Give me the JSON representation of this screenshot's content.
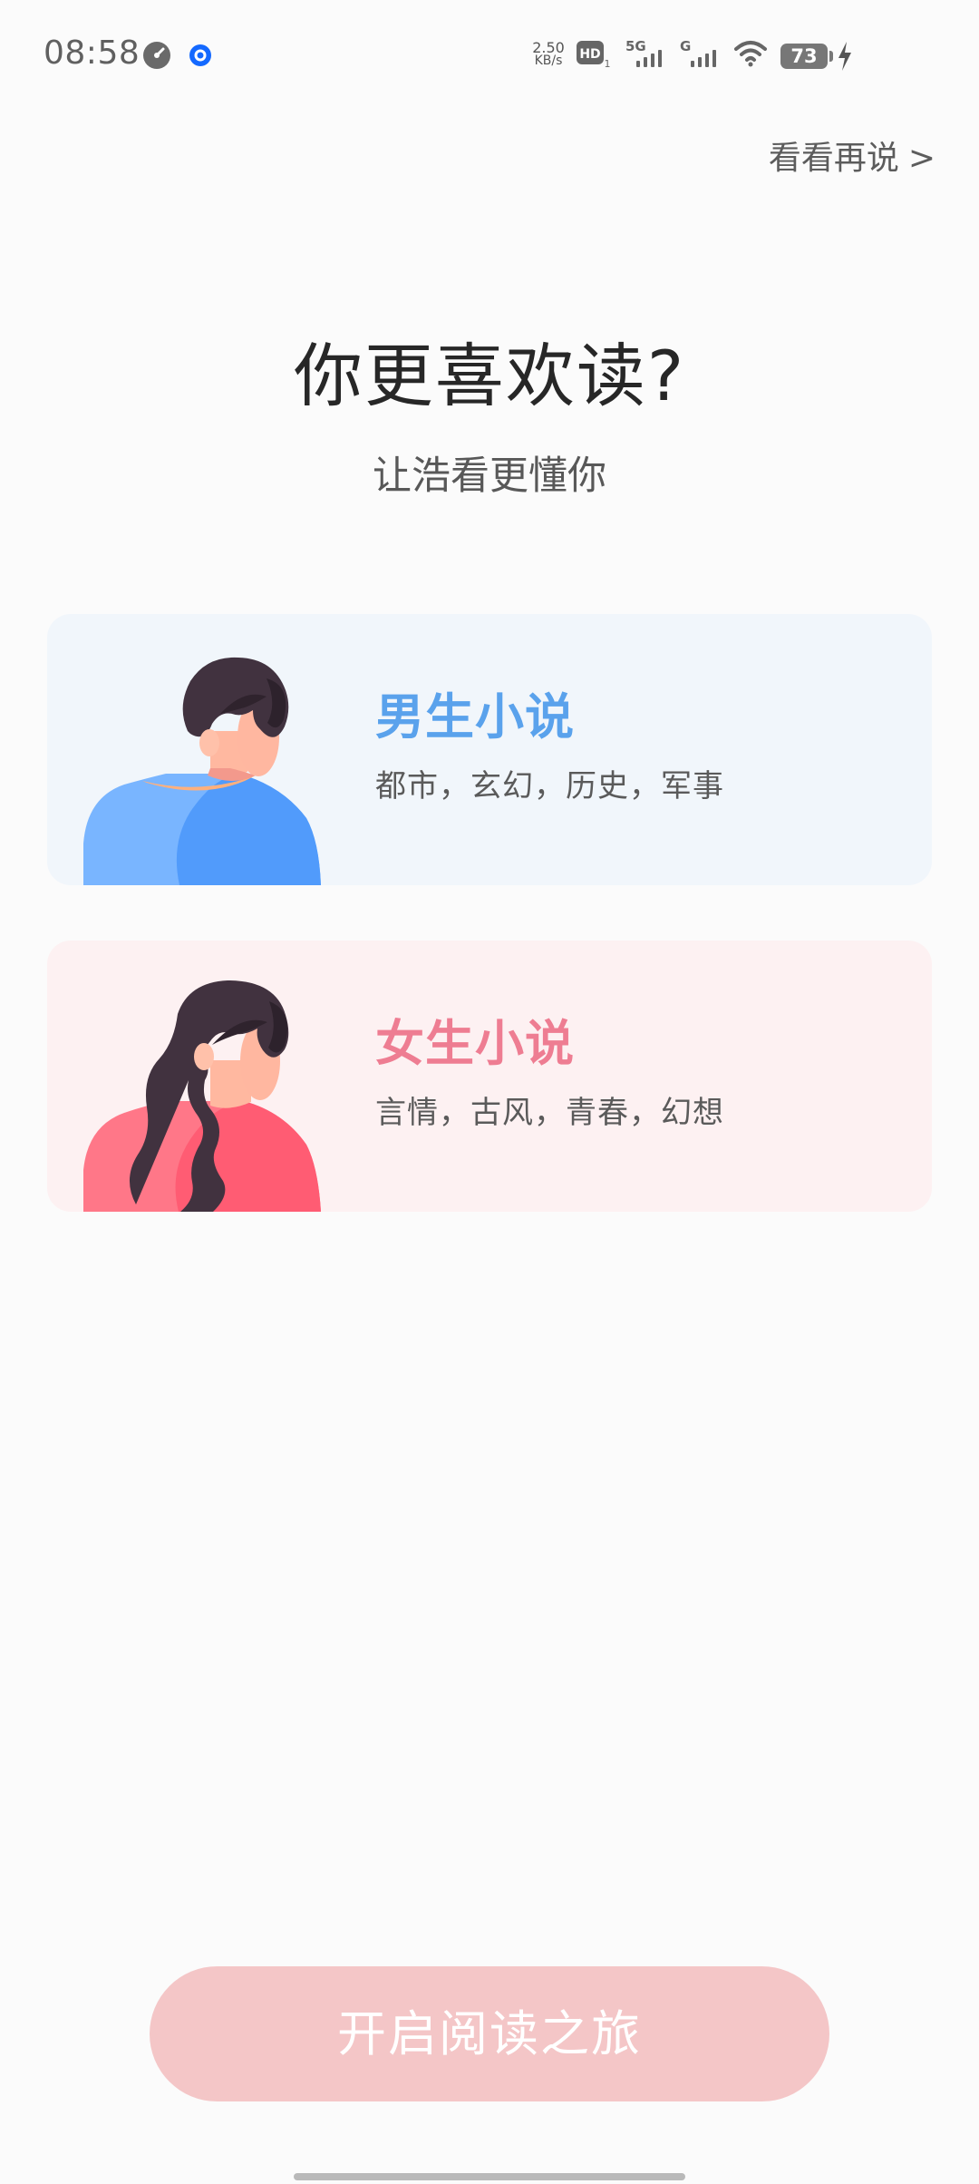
{
  "status_bar": {
    "time": "08:58",
    "network_speed_value": "2.50",
    "network_speed_unit": "KB/s",
    "hd_label": "HD",
    "hd_sub": "1",
    "signal_primary_label": "5G",
    "signal_secondary_label": "G",
    "battery_level": "73",
    "icons": [
      "gauge-icon",
      "app-notification-icon",
      "hd-icon",
      "signal-5g-icon",
      "signal-g-icon",
      "wifi-icon",
      "battery-icon",
      "charging-icon"
    ]
  },
  "header": {
    "skip_label": "看看再说",
    "skip_chevron": ">"
  },
  "main": {
    "title": "你更喜欢读?",
    "subtitle": "让浩看更懂你"
  },
  "genres": [
    {
      "title": "男生小说",
      "description": "都市，玄幻，历史，军事",
      "accent_color": "#5aa2ec",
      "background_color": "#f1f6fb",
      "avatar": "male-avatar-icon"
    },
    {
      "title": "女生小说",
      "description": "言情，古风，青春，幻想",
      "accent_color": "#ee7d92",
      "background_color": "#fdf1f2",
      "avatar": "female-avatar-icon"
    }
  ],
  "footer": {
    "start_button_label": "开启阅读之旅",
    "start_button_color": "#f4c6c7"
  }
}
